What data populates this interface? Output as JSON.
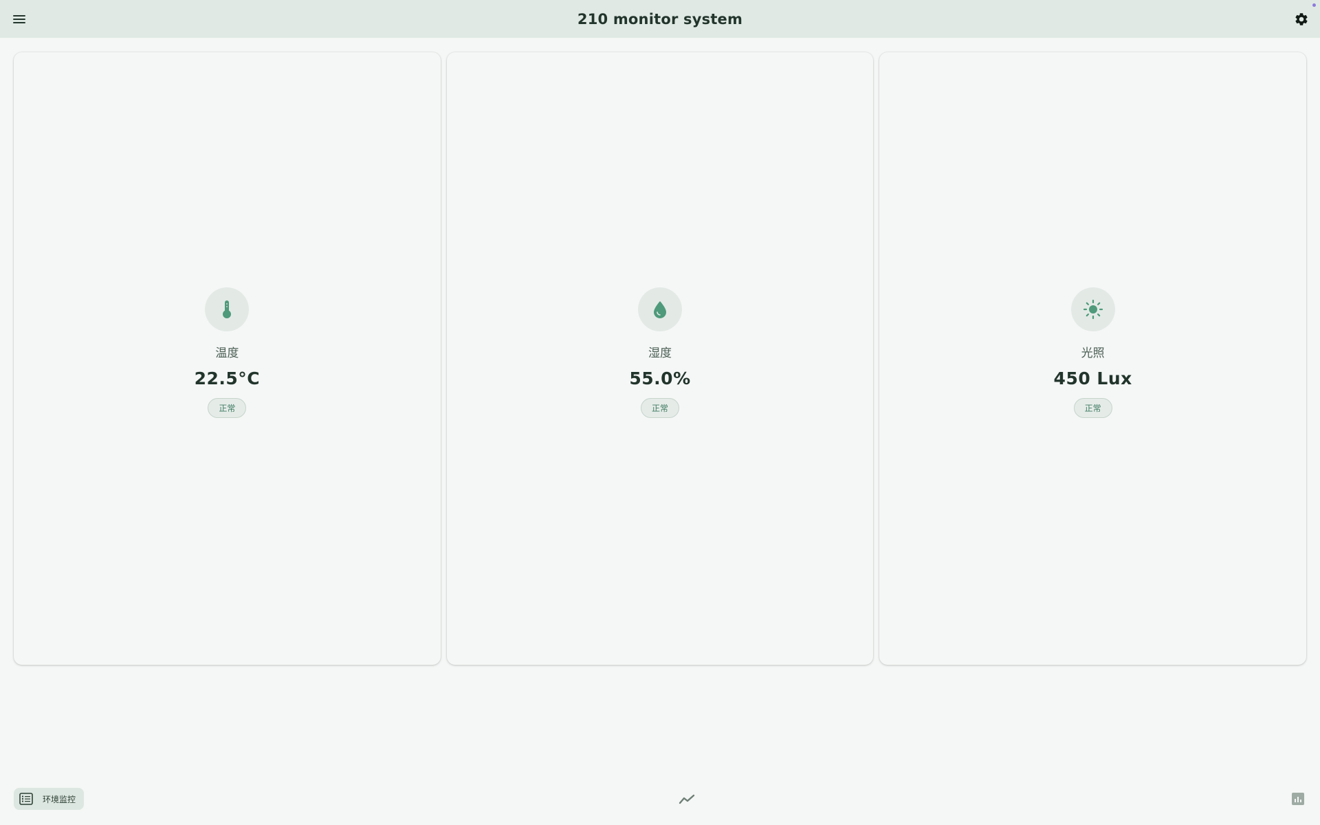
{
  "app": {
    "title": "210 monitor system"
  },
  "header": {
    "menu_icon": "menu-icon",
    "settings_icon": "gear-icon"
  },
  "sensors": [
    {
      "icon": "thermometer-icon",
      "label": "温度",
      "value": "22.5°C",
      "status": "正常"
    },
    {
      "icon": "water-drop-icon",
      "label": "湿度",
      "value": "55.0%",
      "status": "正常"
    },
    {
      "icon": "sun-icon",
      "label": "光照",
      "value": "450 Lux",
      "status": "正常"
    }
  ],
  "bottom_nav": {
    "items": [
      {
        "icon": "list-icon",
        "label": "环境监控",
        "active": true
      },
      {
        "icon": "trend-icon",
        "label": ""
      },
      {
        "icon": "bar-chart-icon",
        "label": ""
      }
    ]
  },
  "colors": {
    "accent": "#4e9a7a",
    "appbar": "#e0e9e4",
    "background": "#f4f7f5",
    "status_text": "#3f7a62"
  }
}
